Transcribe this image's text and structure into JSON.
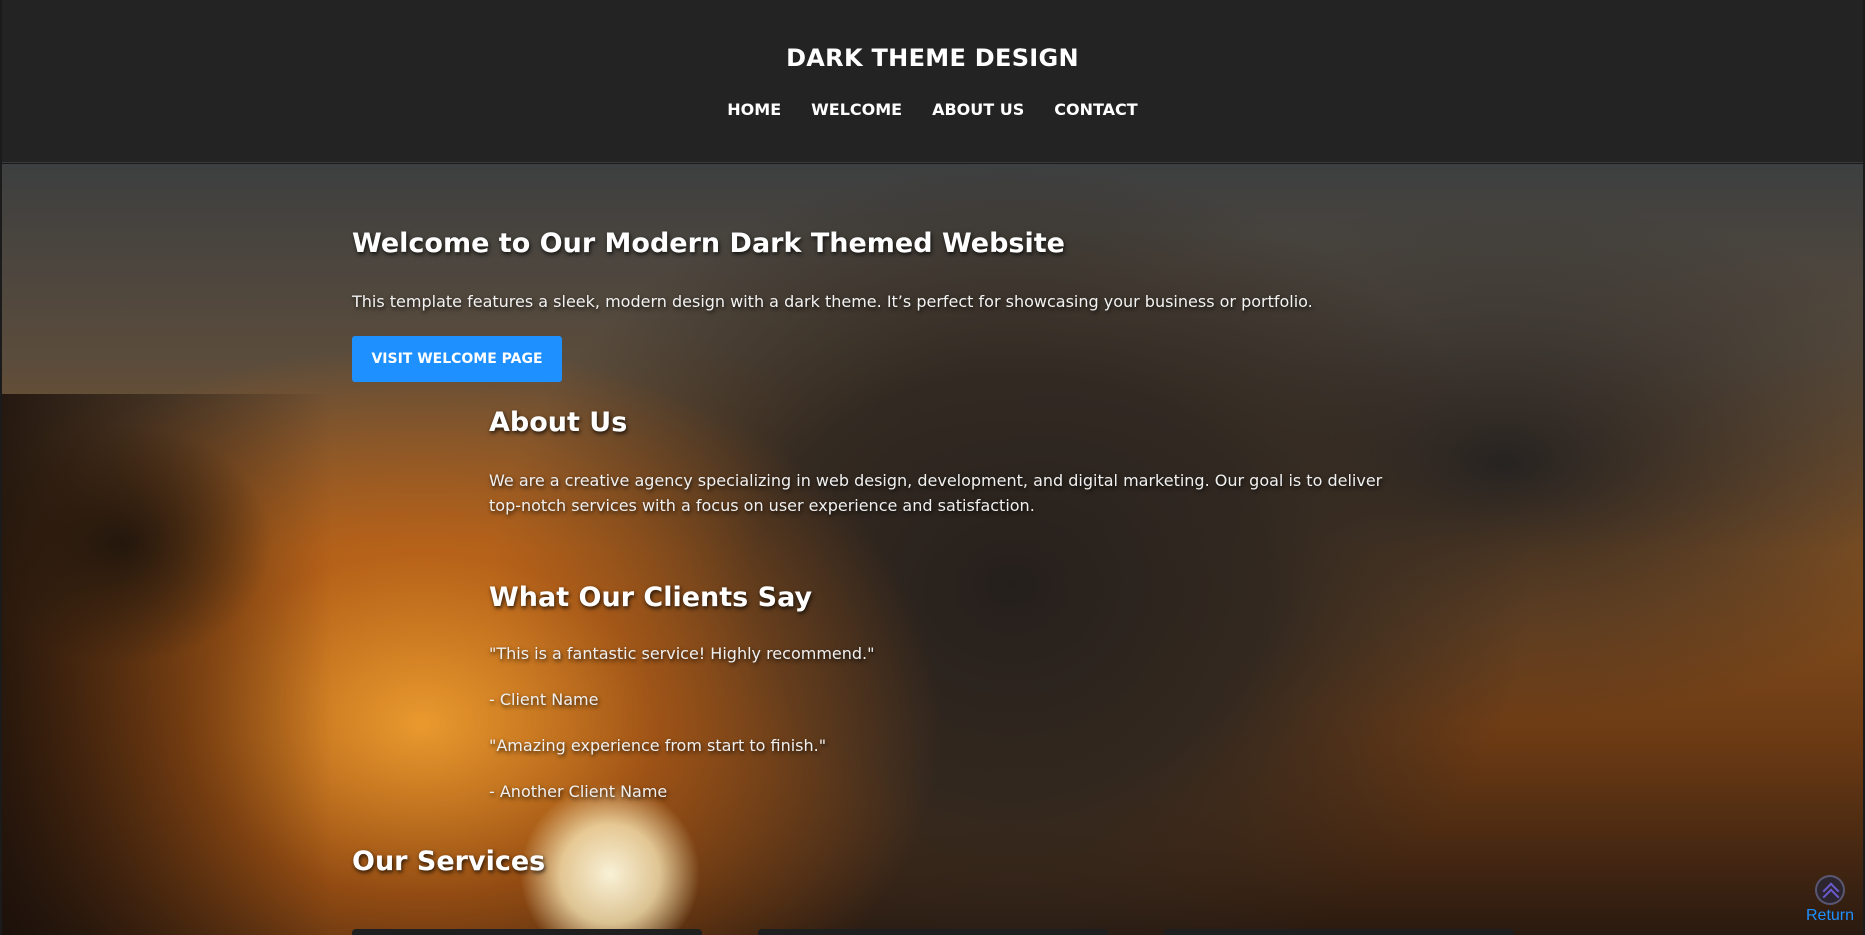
{
  "header": {
    "title": "DARK THEME DESIGN",
    "nav": [
      "HOME",
      "WELCOME",
      "ABOUT US",
      "CONTACT"
    ]
  },
  "hero": {
    "title": "Welcome to Our Modern Dark Themed Website",
    "text": "This template features a sleek, modern design with a dark theme. It’s perfect for showcasing your business or portfolio.",
    "button_label": "VISIT WELCOME PAGE"
  },
  "about": {
    "title": "About Us",
    "text": "We are a creative agency specializing in web design, development, and digital marketing. Our goal is to deliver top-notch services with a focus on user experience and satisfaction."
  },
  "testimonials": {
    "title": "What Our Clients Say",
    "items": [
      "\"This is a fantastic service! Highly recommend.\"",
      "- Client Name",
      "\"Amazing experience from start to finish.\"",
      "- Another Client Name"
    ]
  },
  "services": {
    "title": "Our Services"
  },
  "return_link": {
    "label": "Return",
    "icon": "double-chevron-up-icon",
    "color": "#1e90ff"
  },
  "colors": {
    "header_bg": "#232323",
    "accent": "#1e90ff"
  }
}
